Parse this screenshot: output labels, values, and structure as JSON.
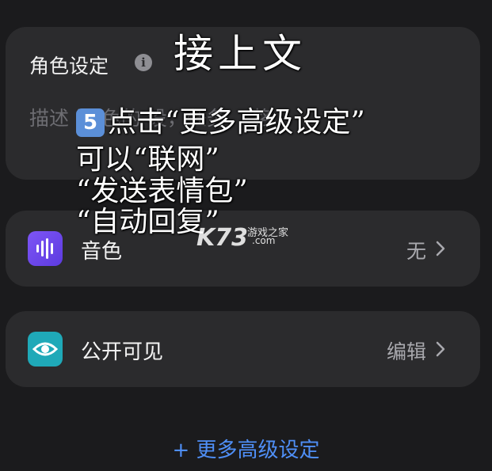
{
  "role_settings": {
    "title": "角色设定",
    "info_icon": "info-icon",
    "placeholder": "描述    设    色的    设，任务，    格"
  },
  "rows": [
    {
      "label": "音色",
      "value": "无",
      "icon": "waveform-icon",
      "icon_color": "#6a45ee"
    },
    {
      "label": "公开可见",
      "value": "编辑",
      "icon": "eye-icon",
      "icon_color": "#1fa9b8"
    }
  ],
  "more_settings": "+ 更多高级设定",
  "overlay": {
    "title": "接上文",
    "keycap": "5",
    "line1": "点击“更多高级设定”",
    "line2": "可以“联网”",
    "line3": "“发送表情包”",
    "line4": "“自动回复”"
  },
  "watermark": {
    "logo": "K73",
    "name": "游戏之家",
    "domain": ".com"
  },
  "colors": {
    "background": "#1b1b1d",
    "card": "#2b2b2d",
    "accent_link": "#4f8ff7"
  }
}
